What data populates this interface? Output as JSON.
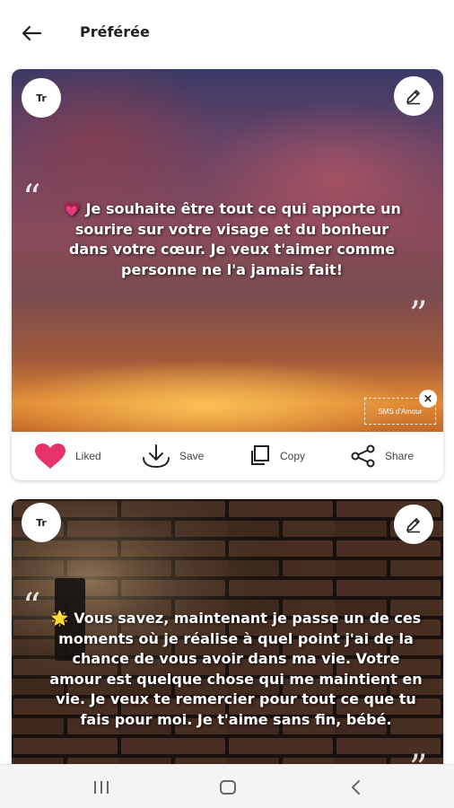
{
  "header": {
    "title": "Préférée",
    "back_icon": "arrow-left-icon"
  },
  "cards": [
    {
      "text_style_label": "Tr",
      "quote_open": "“",
      "quote_close": "”",
      "emoji": "💗",
      "quote": "Je souhaite être tout ce qui apporte un sourire sur votre visage et du bonheur dans votre cœur. Je veux t'aimer comme personne ne l'a jamais fait!",
      "watermark": "SMS d'Amour",
      "watermark_close": "×",
      "actions": {
        "liked": "Liked",
        "save": "Save",
        "copy": "Copy",
        "share": "Share"
      },
      "like_color": "#e8336a"
    },
    {
      "text_style_label": "Tr",
      "quote_open": "“",
      "quote_close": "”",
      "emoji": "🌟",
      "quote": "Vous savez, maintenant je passe un de ces moments où je réalise à quel point j'ai de la chance de vous avoir dans ma vie. Votre amour est quelque chose qui me maintient en vie. Je veux te remercier pour tout ce que tu fais pour moi. Je t'aime sans fin, bébé."
    }
  ],
  "system_nav": {
    "recents_icon": "recents-icon",
    "home_icon": "home-icon",
    "back_icon": "back-chevron-icon"
  }
}
